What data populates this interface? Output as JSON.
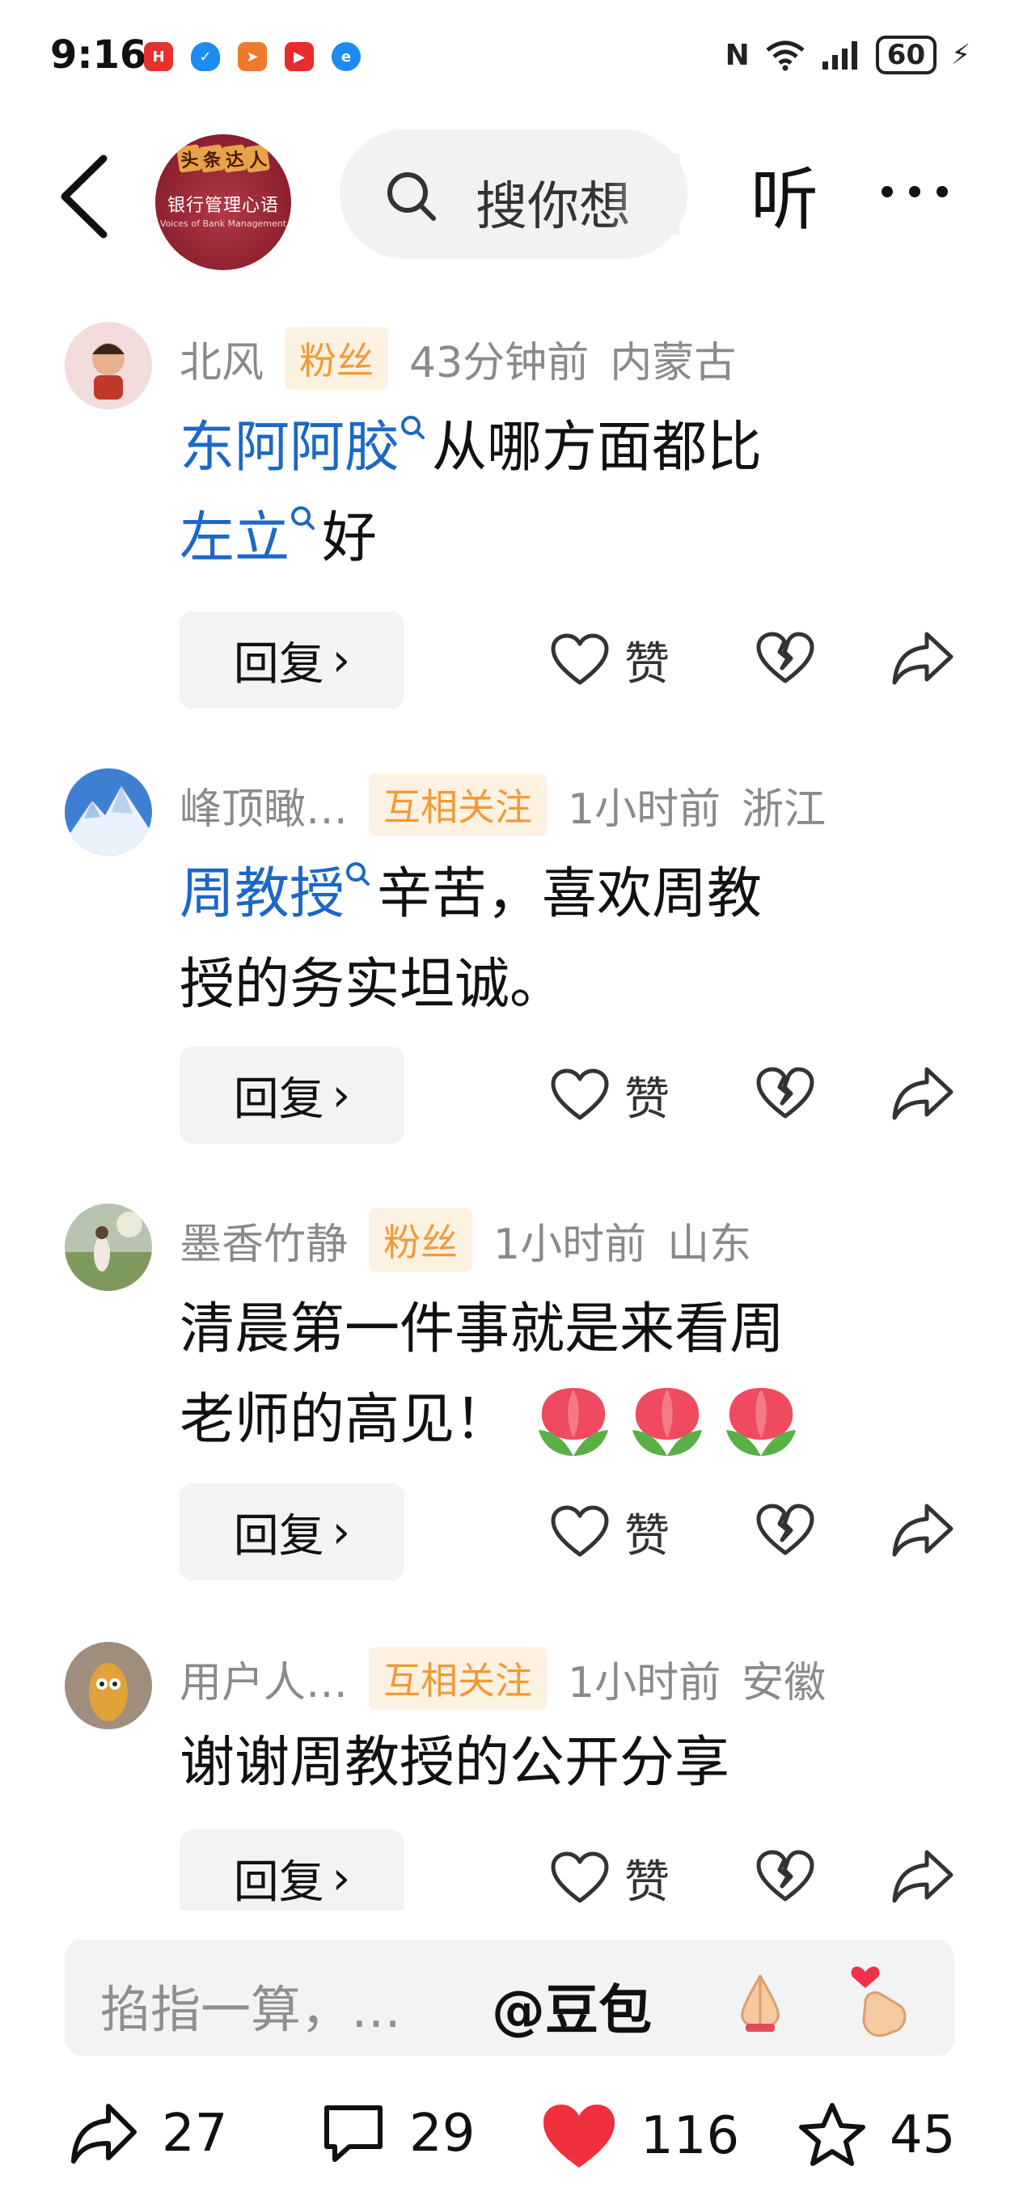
{
  "status_bar": {
    "time": "9:16",
    "battery": "60",
    "apps": [
      {
        "icon": "huawei-icon",
        "color": "#e8302f"
      },
      {
        "icon": "shield-icon",
        "color": "#1c8cf0"
      },
      {
        "icon": "send-icon",
        "color": "#f07a2a"
      },
      {
        "icon": "video-icon",
        "color": "#e82b2b"
      },
      {
        "icon": "browser-icon",
        "color": "#1c8cf0"
      }
    ]
  },
  "header": {
    "logo": {
      "top_chars": [
        "头",
        "条",
        "达",
        "人"
      ],
      "title": "银行管理心语",
      "subtitle": "Voices of Bank Management"
    },
    "search_placeholder": "搜你想",
    "listen_label": "听"
  },
  "comments": [
    {
      "username": "北风",
      "badge": "粉丝",
      "time": "43分钟前",
      "location": "内蒙古",
      "line1": {
        "keyword": "东阿阿胶",
        "text": "从哪方面都比"
      },
      "line2": {
        "keyword": "左立",
        "text": "好"
      }
    },
    {
      "username": "峰顶瞰…",
      "badge": "互相关注",
      "time": "1小时前",
      "location": "浙江",
      "line1": {
        "keyword": "周教授",
        "text": "辛苦，喜欢周教"
      },
      "line2": {
        "text": "授的务实坦诚。"
      }
    },
    {
      "username": "墨香竹静",
      "badge": "粉丝",
      "time": "1小时前",
      "location": "山东",
      "line1": {
        "text": "清晨第一件事就是来看周"
      },
      "line2": {
        "text": "老师的高见！"
      }
    },
    {
      "username": "用户人…",
      "badge": "互相关注",
      "time": "1小时前",
      "location": "安徽",
      "line1": {
        "text": "谢谢周教授的公开分享"
      }
    }
  ],
  "actions": {
    "reply_label": "回复",
    "like_label": "赞"
  },
  "input_bar": {
    "placeholder": "掐指一算，…",
    "mention": "@豆包"
  },
  "toolbar": {
    "share_count": "27",
    "comment_count": "29",
    "like_count": "116",
    "favorite_count": "45"
  },
  "colors": {
    "keyword": "#1b68c6",
    "badge_bg": "#fdf1e2",
    "badge_text": "#f09a38",
    "like_red": "#f0303c"
  }
}
